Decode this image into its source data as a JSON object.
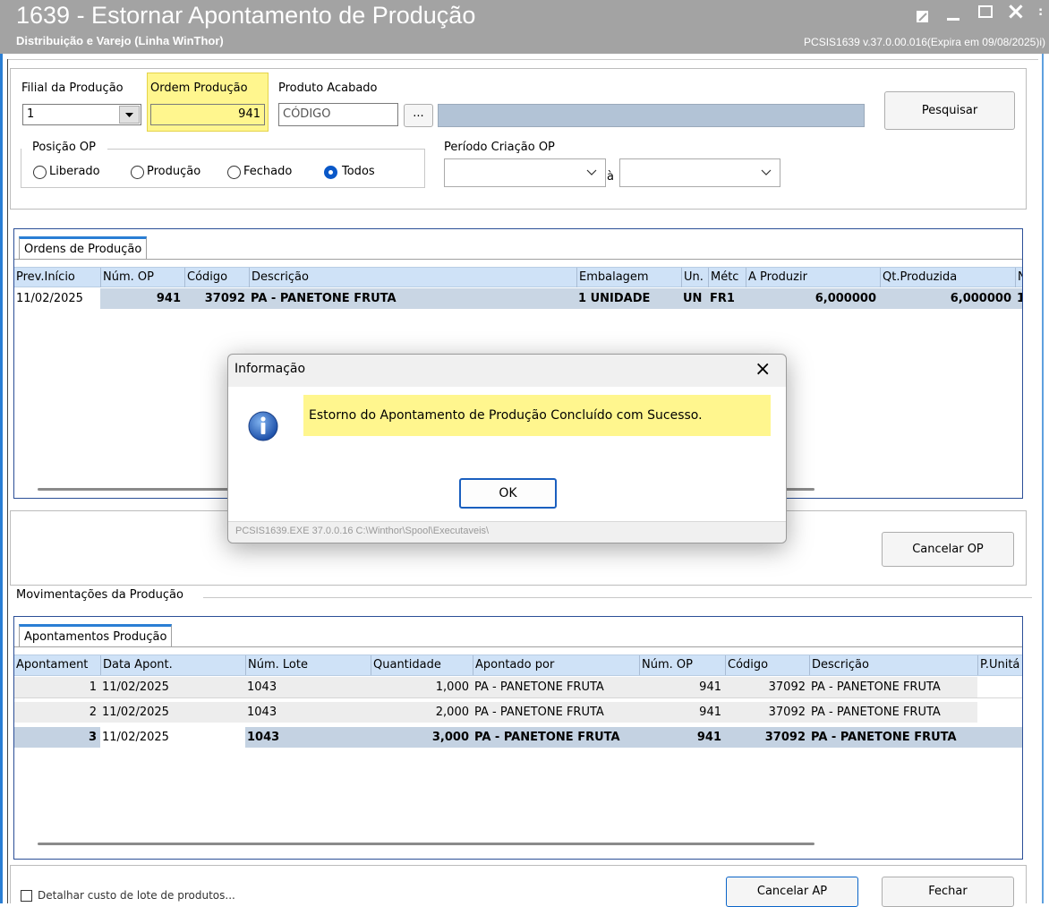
{
  "window": {
    "title": "1639 - Estornar Apontamento de Produção",
    "subtitle": "Distribuição e Varejo (Linha WinThor)",
    "version": "PCSIS1639  v.37.0.00.016(Expira em 09/08/2025)",
    "version_suffix": "i)"
  },
  "filters": {
    "filial_label": "Filial da Produção",
    "filial_value": "1",
    "ordem_label": "Ordem Produção",
    "ordem_value": "941",
    "produto_label": "Produto Acabado",
    "produto_code_placeholder": "CÓDIGO",
    "produto_browse_label": "...",
    "produto_desc_value": "",
    "pesquisar_label": "Pesquisar",
    "posicao_label": "Posição OP",
    "posicao_options": [
      "Liberado",
      "Produção",
      "Fechado",
      "Todos"
    ],
    "posicao_selected": "Todos",
    "periodo_label": "Período Criação OP",
    "periodo_from": "",
    "periodo_sep": "à",
    "periodo_to": ""
  },
  "ordens": {
    "tab_label": "Ordens de Produção",
    "columns": [
      "Prev.Início",
      "Núm. OP",
      "Código",
      "Descrição",
      "Embalagem",
      "Un.",
      "Métc",
      "A Produzir",
      "Qt.Produzida",
      "N"
    ],
    "rows": [
      [
        "11/02/2025",
        "941",
        "37092",
        "PA - PANETONE FRUTA",
        "1 UNIDADE",
        "UN",
        "FR1",
        "6,000000",
        "6,000000",
        "1"
      ]
    ]
  },
  "cancelar_op_label": "Cancelar OP",
  "movimentacoes": {
    "group_label": "Movimentações da Produção",
    "tab_label": "Apontamentos Produção",
    "columns": [
      "Apontament",
      "Data Apont.",
      "Núm. Lote",
      "Quantidade",
      "Apontado por",
      "Núm. OP",
      "Código",
      "Descrição",
      "P.Unitá"
    ],
    "rows": [
      [
        "1",
        "11/02/2025",
        "1043",
        "1,000",
        "PA - PANETONE FRUTA",
        "941",
        "37092",
        "PA - PANETONE FRUTA",
        ""
      ],
      [
        "2",
        "11/02/2025",
        "1043",
        "2,000",
        "PA - PANETONE FRUTA",
        "941",
        "37092",
        "PA - PANETONE FRUTA",
        ""
      ],
      [
        "3",
        "11/02/2025",
        "1043",
        "3,000",
        "PA - PANETONE FRUTA",
        "941",
        "37092",
        "PA - PANETONE FRUTA",
        ""
      ]
    ],
    "selected_row": 2
  },
  "footer": {
    "checkbox_label": "Detalhar custo de lote de produtos...",
    "cancelar_ap_label": "Cancelar AP",
    "fechar_label": "Fechar"
  },
  "dialog": {
    "title": "Informação",
    "message": "Estorno do Apontamento de Produção Concluído com Sucesso.",
    "ok_label": "OK",
    "footer_path": "PCSIS1639.EXE 37.0.0.16 C:\\Winthor\\Spool\\Executaveis\\"
  },
  "colors": {
    "titlebar": "#a3a3a3",
    "accent_blue": "#2a7ed4",
    "highlight_yellow": "#fff68e",
    "grid_header": "#cfe2f7",
    "selected_row": "#c4d2e2"
  }
}
